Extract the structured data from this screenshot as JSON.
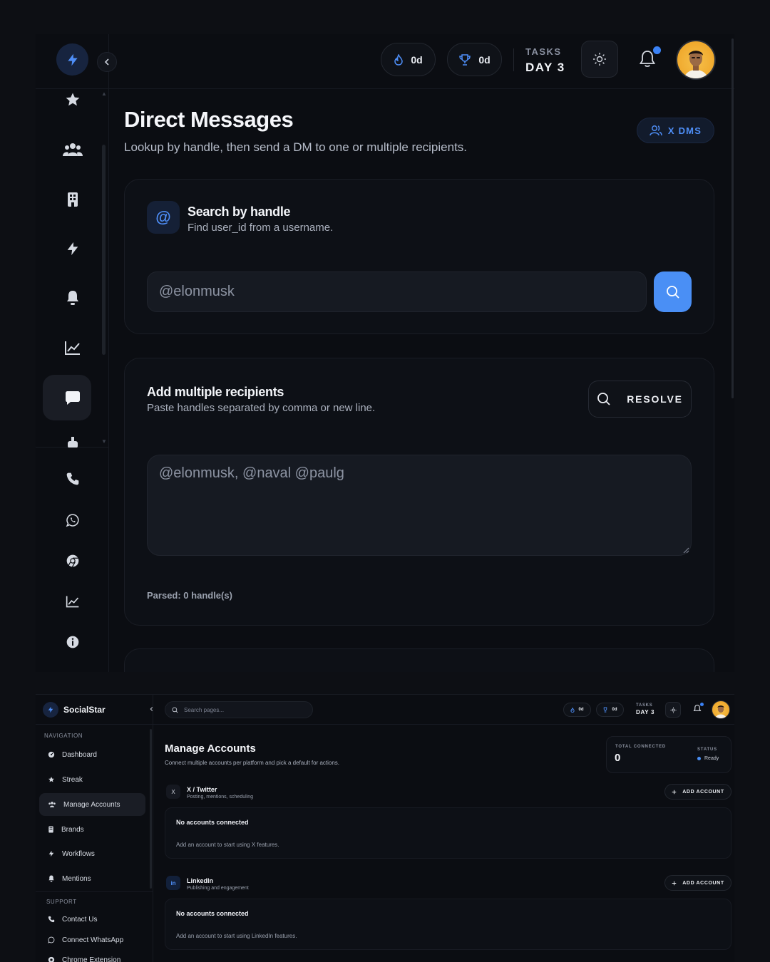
{
  "top": {
    "header": {
      "streak_value": "0d",
      "trophy_value": "0d",
      "tasks_label": "TASKS",
      "tasks_day": "DAY 3"
    },
    "page": {
      "title": "Direct Messages",
      "subtitle": "Lookup by handle, then send a DM to one or multiple recipients.",
      "badge_label": "X DMS"
    },
    "search_card": {
      "title": "Search by handle",
      "subtitle": "Find user_id from a username.",
      "badge": "@",
      "input_placeholder": "@elonmusk"
    },
    "recipients_card": {
      "title": "Add multiple recipients",
      "subtitle": "Paste handles separated by comma or new line.",
      "resolve_label": "RESOLVE",
      "textarea_placeholder": "@elonmusk, @naval @paulg",
      "parsed_text": "Parsed: 0 handle(s)"
    }
  },
  "bottom": {
    "brand": "SocialStar",
    "nav_section": "NAVIGATION",
    "nav_items": [
      {
        "label": "Dashboard",
        "icon": "dashboard-icon"
      },
      {
        "label": "Streak",
        "icon": "star-icon"
      },
      {
        "label": "Manage Accounts",
        "icon": "users-icon",
        "active": true
      },
      {
        "label": "Brands",
        "icon": "building-icon"
      },
      {
        "label": "Workflows",
        "icon": "lightning-icon"
      },
      {
        "label": "Mentions",
        "icon": "bell-icon"
      }
    ],
    "support_section": "SUPPORT",
    "support_items": [
      {
        "label": "Contact Us",
        "icon": "phone-icon"
      },
      {
        "label": "Connect WhatsApp",
        "icon": "whatsapp-icon"
      },
      {
        "label": "Chrome Extension",
        "icon": "chrome-icon"
      }
    ],
    "search_placeholder": "Search pages...",
    "header": {
      "streak_value": "0d",
      "trophy_value": "0d",
      "tasks_label": "TASKS",
      "tasks_day": "DAY 3"
    },
    "page": {
      "title": "Manage Accounts",
      "subtitle": "Connect multiple accounts per platform and pick a default for actions."
    },
    "stats": {
      "total_label": "TOTAL CONNECTED",
      "total_value": "0",
      "status_label": "STATUS",
      "status_value": "Ready"
    },
    "platforms": [
      {
        "name": "X / Twitter",
        "icon_glyph": "X",
        "description": "Posting, mentions, scheduling",
        "add_label": "ADD ACCOUNT",
        "empty_title": "No accounts connected",
        "empty_sub": "Add an account to start using X features."
      },
      {
        "name": "LinkedIn",
        "icon_glyph": "in",
        "description": "Publishing and engagement",
        "add_label": "ADD ACCOUNT",
        "empty_title": "No accounts connected",
        "empty_sub": "Add an account to start using LinkedIn features."
      }
    ]
  },
  "colors": {
    "accent": "#4a8ff5",
    "background": "#0b0d12",
    "card": "#0d1016",
    "avatar": "#f0a92d"
  }
}
